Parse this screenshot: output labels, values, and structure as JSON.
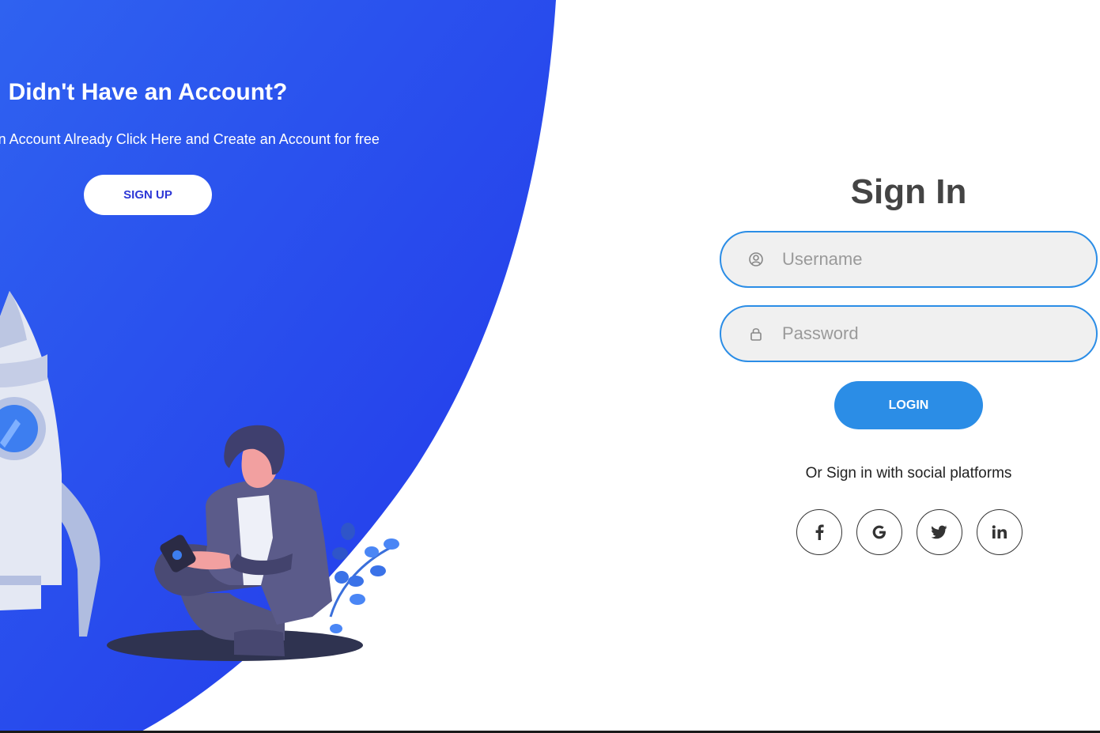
{
  "left_panel": {
    "title": "Didn't Have an Account?",
    "text": "Don't Have an Account Already Click Here and Create an Account for free",
    "signup_label": "SIGN UP",
    "accent_color": "#2448ee"
  },
  "signin": {
    "title": "Sign In",
    "username_placeholder": "Username",
    "password_placeholder": "Password",
    "login_label": "LOGIN",
    "social_text": "Or Sign in with social platforms",
    "social": [
      {
        "icon": "facebook-icon",
        "glyph": "f"
      },
      {
        "icon": "google-icon",
        "glyph": "G"
      },
      {
        "icon": "twitter-icon",
        "glyph": "🐦"
      },
      {
        "icon": "linkedin-icon",
        "glyph": "in"
      }
    ],
    "accent_color": "#2b8de6"
  }
}
